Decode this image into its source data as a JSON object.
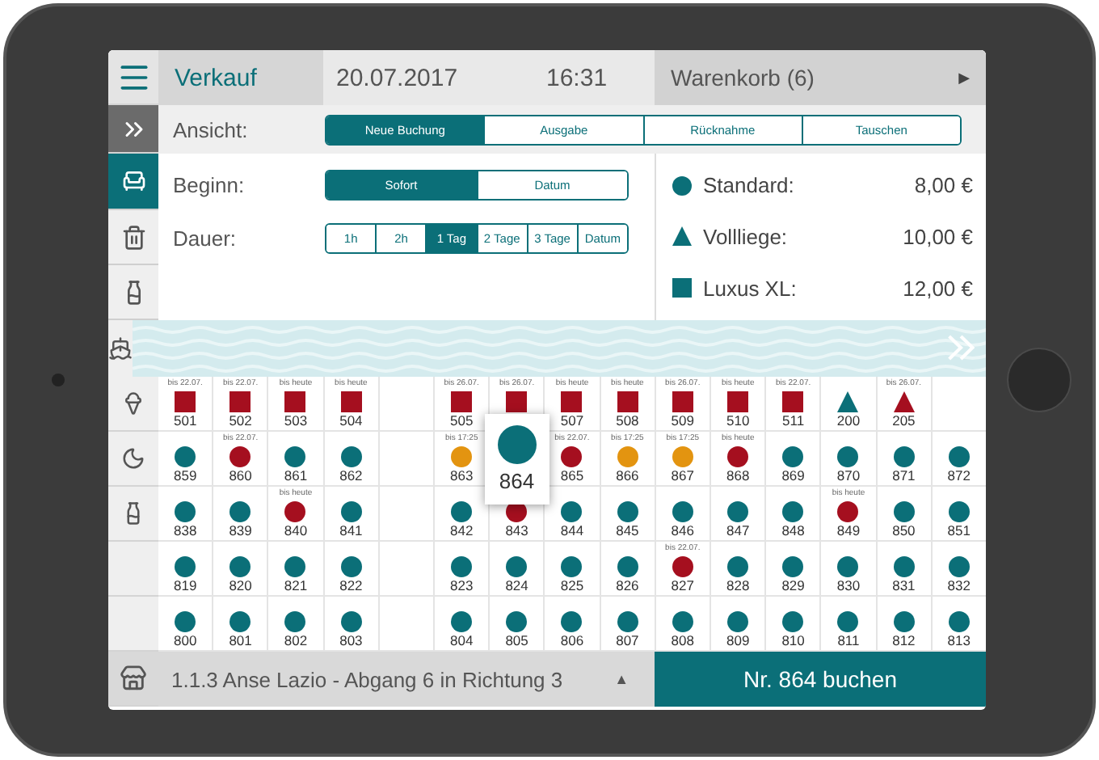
{
  "top_bar": {
    "section": "Verkauf",
    "date": "20.07.2017",
    "time": "16:31",
    "cart": "Warenkorb (6)",
    "cart_arrow": "▶"
  },
  "sidebar_items": [
    {
      "kind": "armchair",
      "selected": true
    },
    {
      "kind": "trash",
      "selected": false
    },
    {
      "kind": "bottle",
      "selected": false
    }
  ],
  "map_category": {
    "kind": "ship",
    "selected": false
  },
  "view": {
    "label": "Ansicht:",
    "options": [
      {
        "label": "Neue Buchung",
        "selected": true
      },
      {
        "label": "Ausgabe",
        "selected": false
      },
      {
        "label": "Rücknahme",
        "selected": false
      },
      {
        "label": "Tauschen",
        "selected": false
      }
    ]
  },
  "start": {
    "label": "Beginn:",
    "options": [
      {
        "label": "Sofort",
        "selected": true
      },
      {
        "label": "Datum",
        "selected": false
      }
    ]
  },
  "duration": {
    "label": "Dauer:",
    "options": [
      {
        "label": "1h",
        "selected": false
      },
      {
        "label": "2h",
        "selected": false
      },
      {
        "label": "1 Tag",
        "selected": true
      },
      {
        "label": "2 Tage",
        "selected": false
      },
      {
        "label": "3 Tage",
        "selected": false
      },
      {
        "label": "Datum",
        "selected": false
      }
    ]
  },
  "prices": [
    {
      "kind": "circle",
      "name": "Standard:",
      "price": "8,00 €"
    },
    {
      "kind": "triangle",
      "name": "Vollliege:",
      "price": "10,00 €"
    },
    {
      "kind": "square",
      "name": "Luxus XL:",
      "price": "12,00 €"
    }
  ],
  "rows": [
    {
      "kind": "ice-cream",
      "spots": [
        {
          "kind": "square",
          "number": "501",
          "color": "#a50f1f",
          "note": "bis 22.07.",
          "selected": false
        },
        {
          "kind": "square",
          "number": "502",
          "color": "#a50f1f",
          "note": "bis 22.07.",
          "selected": false
        },
        {
          "kind": "square",
          "number": "503",
          "color": "#a50f1f",
          "note": "bis heute",
          "selected": false
        },
        {
          "kind": "square",
          "number": "504",
          "color": "#a50f1f",
          "note": "bis heute",
          "selected": false
        },
        {
          "kind": "empty"
        },
        {
          "kind": "square",
          "number": "505",
          "color": "#a50f1f",
          "note": "bis 26.07.",
          "selected": false
        },
        {
          "kind": "square",
          "color": "#a50f1f",
          "note": "bis 26.07.",
          "selected": false
        },
        {
          "kind": "square",
          "number": "507",
          "color": "#a50f1f",
          "note": "bis heute",
          "selected": false
        },
        {
          "kind": "square",
          "number": "508",
          "color": "#a50f1f",
          "note": "bis heute",
          "selected": false
        },
        {
          "kind": "square",
          "number": "509",
          "color": "#a50f1f",
          "note": "bis 26.07.",
          "selected": false
        },
        {
          "kind": "square",
          "number": "510",
          "color": "#a50f1f",
          "note": "bis heute",
          "selected": false
        },
        {
          "kind": "square",
          "number": "511",
          "color": "#a50f1f",
          "note": "bis 22.07.",
          "selected": false
        },
        {
          "kind": "triangle",
          "number": "200",
          "color": "#0b6f78",
          "selected": false
        },
        {
          "kind": "triangle",
          "number": "205",
          "color": "#a50f1f",
          "note": "bis 26.07.",
          "selected": false
        },
        {
          "kind": "empty"
        }
      ]
    },
    {
      "kind": "moon",
      "spots": [
        {
          "kind": "circle",
          "number": "859",
          "color": "#0b6f78",
          "selected": false
        },
        {
          "kind": "circle",
          "number": "860",
          "color": "#a50f1f",
          "note": "bis 22.07.",
          "selected": false
        },
        {
          "kind": "circle",
          "number": "861",
          "color": "#0b6f78",
          "selected": false
        },
        {
          "kind": "circle",
          "number": "862",
          "color": "#0b6f78",
          "selected": false
        },
        {
          "kind": "empty"
        },
        {
          "kind": "circle",
          "number": "863",
          "color": "#e39410",
          "note": "bis 17:25",
          "selected": false
        },
        {
          "kind": "circle",
          "number": "864",
          "color": "#0b6f78",
          "selected": true
        },
        {
          "kind": "circle",
          "number": "865",
          "color": "#a50f1f",
          "note": "bis 22.07.",
          "selected": false
        },
        {
          "kind": "circle",
          "number": "866",
          "color": "#e39410",
          "note": "bis 17:25",
          "selected": false
        },
        {
          "kind": "circle",
          "number": "867",
          "color": "#e39410",
          "note": "bis 17:25",
          "selected": false
        },
        {
          "kind": "circle",
          "number": "868",
          "color": "#a50f1f",
          "note": "bis heute",
          "selected": false
        },
        {
          "kind": "circle",
          "number": "869",
          "color": "#0b6f78",
          "selected": false
        },
        {
          "kind": "circle",
          "number": "870",
          "color": "#0b6f78",
          "selected": false
        },
        {
          "kind": "circle",
          "number": "871",
          "color": "#0b6f78",
          "selected": false
        },
        {
          "kind": "circle",
          "number": "872",
          "color": "#0b6f78",
          "selected": false
        }
      ]
    },
    {
      "kind": "bottle",
      "spots": [
        {
          "kind": "circle",
          "number": "838",
          "color": "#0b6f78",
          "selected": false
        },
        {
          "kind": "circle",
          "number": "839",
          "color": "#0b6f78",
          "selected": false
        },
        {
          "kind": "circle",
          "number": "840",
          "color": "#a50f1f",
          "note": "bis heute",
          "selected": false
        },
        {
          "kind": "circle",
          "number": "841",
          "color": "#0b6f78",
          "selected": false
        },
        {
          "kind": "empty"
        },
        {
          "kind": "circle",
          "number": "842",
          "color": "#0b6f78",
          "selected": false
        },
        {
          "kind": "circle",
          "number": "843",
          "color": "#a50f1f",
          "selected": false
        },
        {
          "kind": "circle",
          "number": "844",
          "color": "#0b6f78",
          "selected": false
        },
        {
          "kind": "circle",
          "number": "845",
          "color": "#0b6f78",
          "selected": false
        },
        {
          "kind": "circle",
          "number": "846",
          "color": "#0b6f78",
          "selected": false
        },
        {
          "kind": "circle",
          "number": "847",
          "color": "#0b6f78",
          "selected": false
        },
        {
          "kind": "circle",
          "number": "848",
          "color": "#0b6f78",
          "selected": false
        },
        {
          "kind": "circle",
          "number": "849",
          "color": "#a50f1f",
          "note": "bis heute",
          "selected": false
        },
        {
          "kind": "circle",
          "number": "850",
          "color": "#0b6f78",
          "selected": false
        },
        {
          "kind": "circle",
          "number": "851",
          "color": "#0b6f78",
          "selected": false
        }
      ]
    },
    {
      "kind": "none",
      "spots": [
        {
          "kind": "circle",
          "number": "819",
          "color": "#0b6f78",
          "selected": false
        },
        {
          "kind": "circle",
          "number": "820",
          "color": "#0b6f78",
          "selected": false
        },
        {
          "kind": "circle",
          "number": "821",
          "color": "#0b6f78",
          "selected": false
        },
        {
          "kind": "circle",
          "number": "822",
          "color": "#0b6f78",
          "selected": false
        },
        {
          "kind": "empty"
        },
        {
          "kind": "circle",
          "number": "823",
          "color": "#0b6f78",
          "selected": false
        },
        {
          "kind": "circle",
          "number": "824",
          "color": "#0b6f78",
          "selected": false
        },
        {
          "kind": "circle",
          "number": "825",
          "color": "#0b6f78",
          "selected": false
        },
        {
          "kind": "circle",
          "number": "826",
          "color": "#0b6f78",
          "selected": false
        },
        {
          "kind": "circle",
          "number": "827",
          "color": "#a50f1f",
          "note": "bis 22.07.",
          "selected": false
        },
        {
          "kind": "circle",
          "number": "828",
          "color": "#0b6f78",
          "selected": false
        },
        {
          "kind": "circle",
          "number": "829",
          "color": "#0b6f78",
          "selected": false
        },
        {
          "kind": "circle",
          "number": "830",
          "color": "#0b6f78",
          "selected": false
        },
        {
          "kind": "circle",
          "number": "831",
          "color": "#0b6f78",
          "selected": false
        },
        {
          "kind": "circle",
          "number": "832",
          "color": "#0b6f78",
          "selected": false
        }
      ]
    },
    {
      "kind": "none",
      "spots": [
        {
          "kind": "circle",
          "number": "800",
          "color": "#0b6f78",
          "selected": false
        },
        {
          "kind": "circle",
          "number": "801",
          "color": "#0b6f78",
          "selected": false
        },
        {
          "kind": "circle",
          "number": "802",
          "color": "#0b6f78",
          "selected": false
        },
        {
          "kind": "circle",
          "number": "803",
          "color": "#0b6f78",
          "selected": false
        },
        {
          "kind": "empty"
        },
        {
          "kind": "circle",
          "number": "804",
          "color": "#0b6f78",
          "selected": false
        },
        {
          "kind": "circle",
          "number": "805",
          "color": "#0b6f78",
          "selected": false
        },
        {
          "kind": "circle",
          "number": "806",
          "color": "#0b6f78",
          "selected": false
        },
        {
          "kind": "circle",
          "number": "807",
          "color": "#0b6f78",
          "selected": false
        },
        {
          "kind": "circle",
          "number": "808",
          "color": "#0b6f78",
          "selected": false
        },
        {
          "kind": "circle",
          "number": "809",
          "color": "#0b6f78",
          "selected": false
        },
        {
          "kind": "circle",
          "number": "810",
          "color": "#0b6f78",
          "selected": false
        },
        {
          "kind": "circle",
          "number": "811",
          "color": "#0b6f78",
          "selected": false
        },
        {
          "kind": "circle",
          "number": "812",
          "color": "#0b6f78",
          "selected": false
        },
        {
          "kind": "circle",
          "number": "813",
          "color": "#0b6f78",
          "selected": false
        }
      ]
    }
  ],
  "location": {
    "text": "1.1.3 Anse Lazio - Abgang 6 in Richtung 3",
    "arrow": "▲"
  },
  "book_button": "Nr. 864 buchen"
}
